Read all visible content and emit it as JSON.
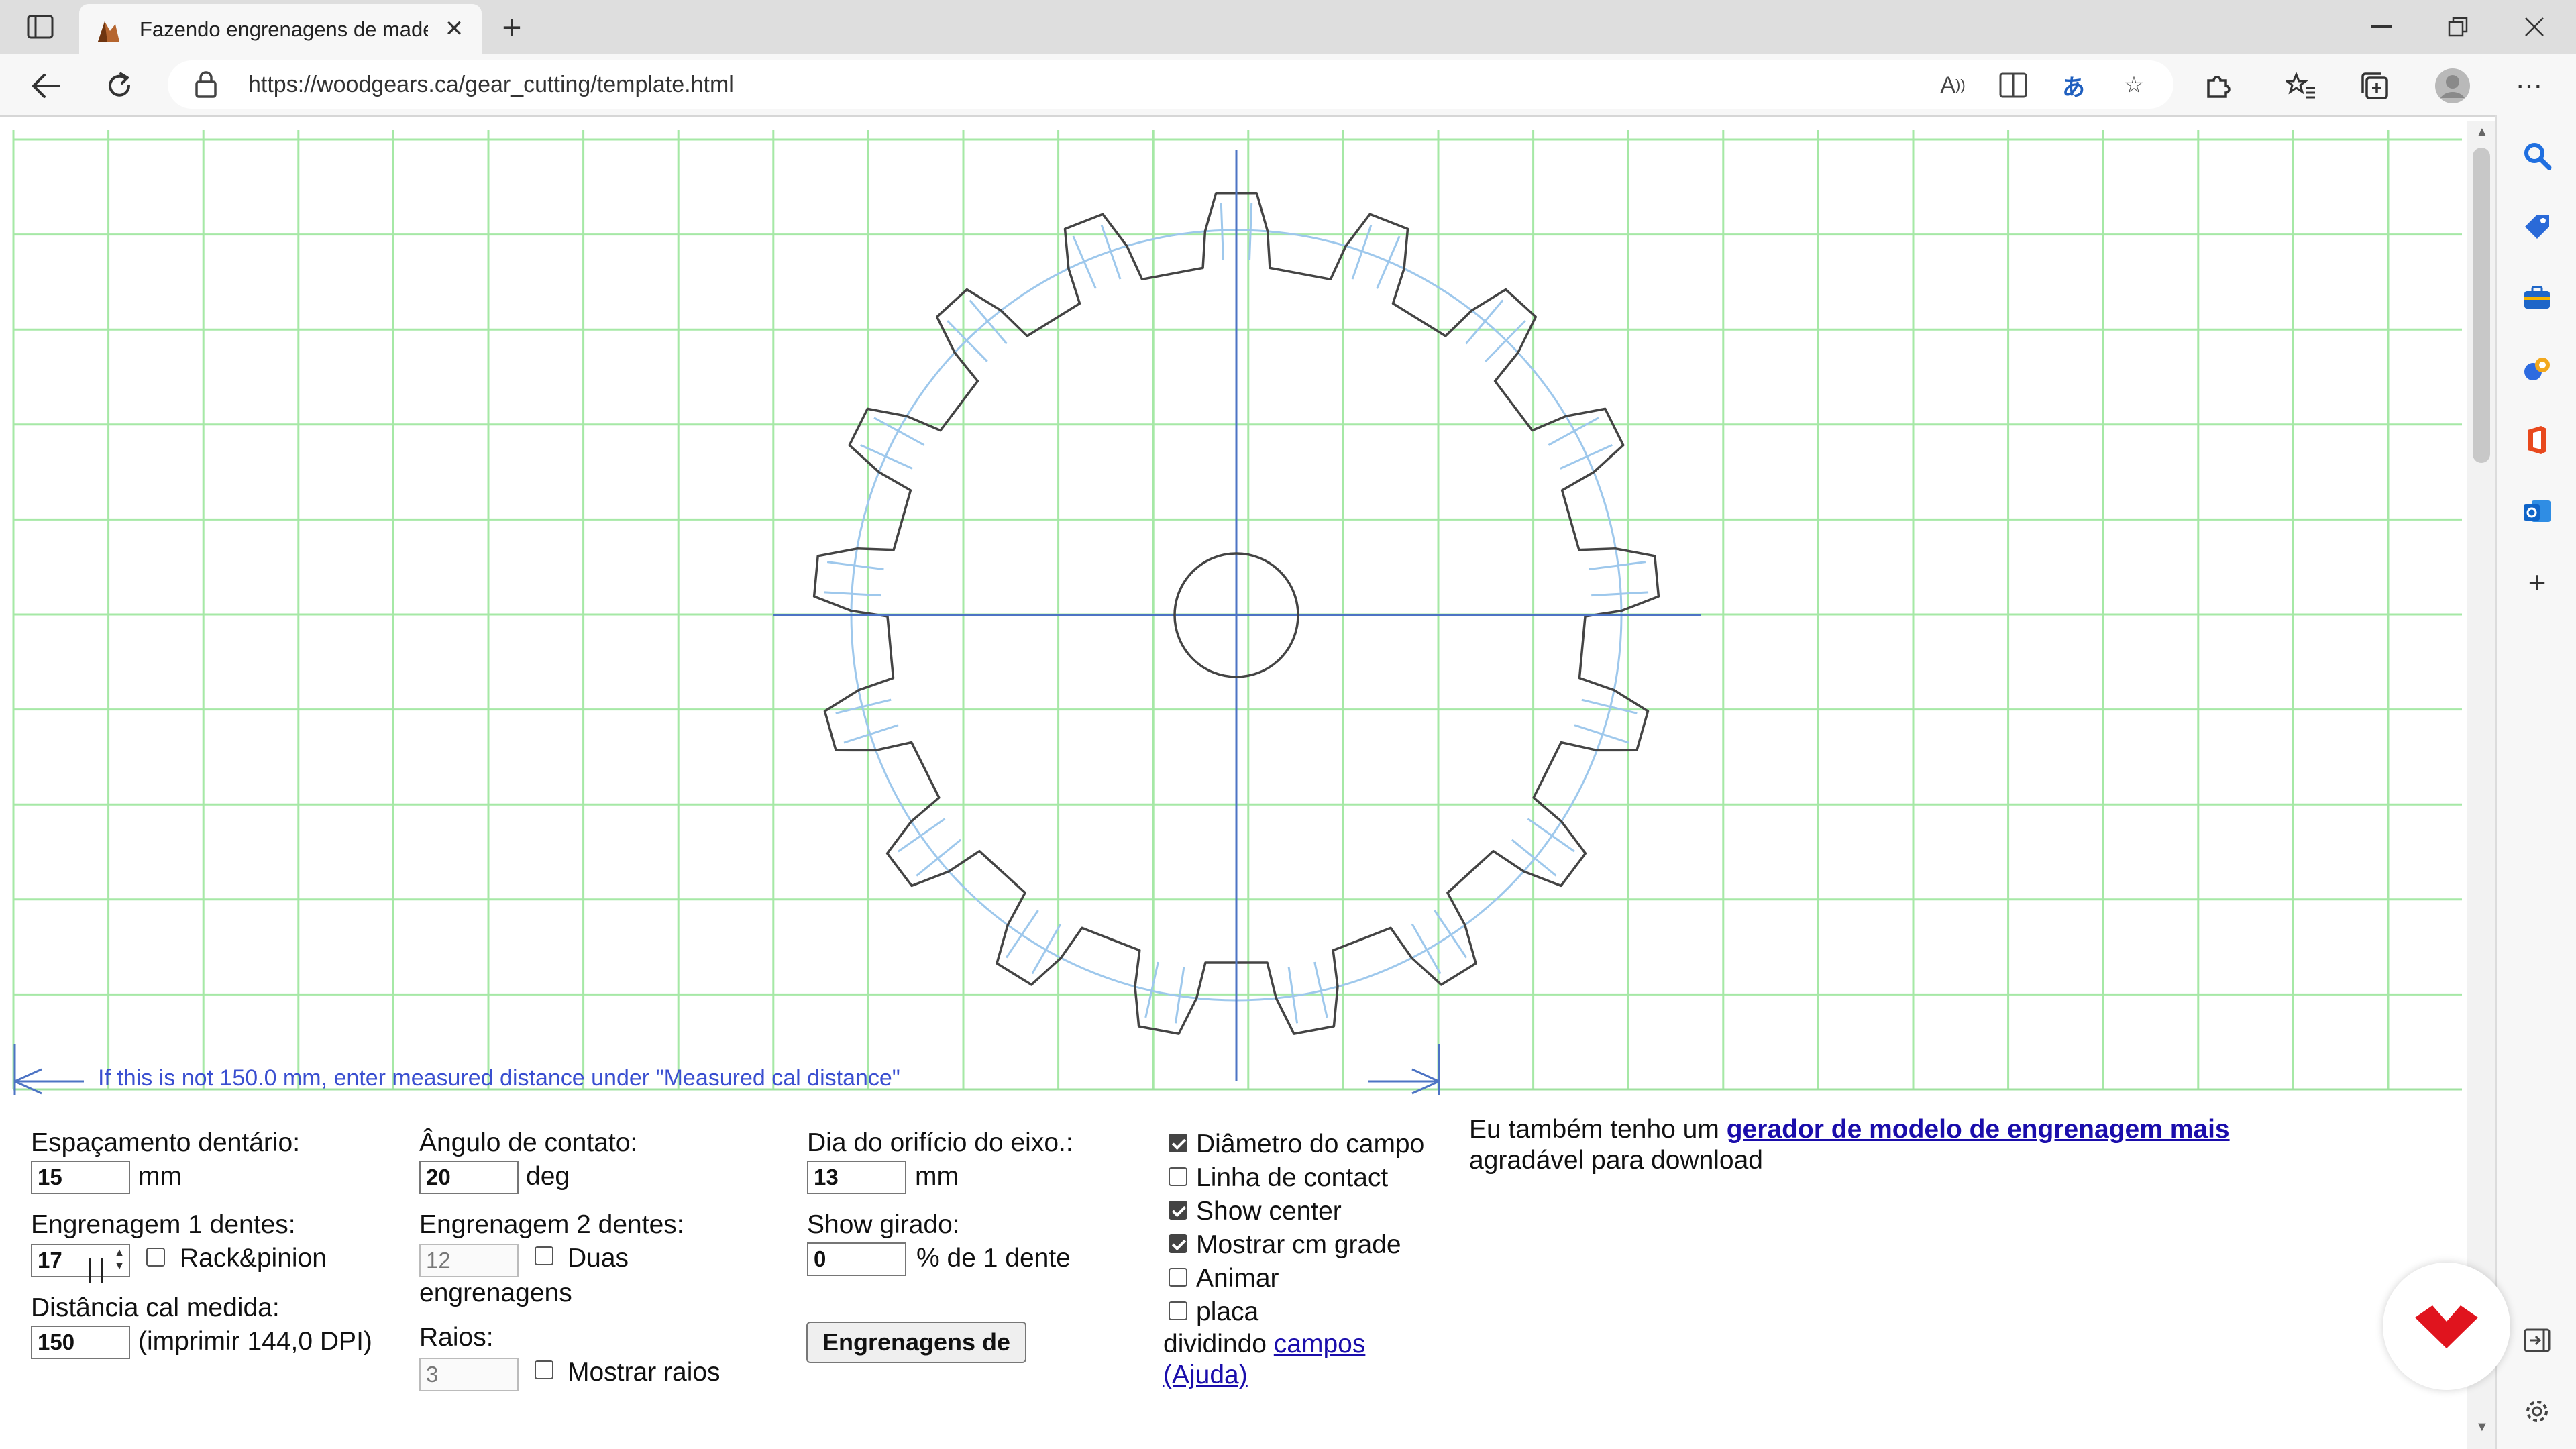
{
  "browser": {
    "tab": {
      "title": "Fazendo engrenagens de madeira"
    },
    "address": {
      "url": "https://woodgears.ca/gear_cutting/template.html"
    }
  },
  "template": {
    "calibration_text": "If this is not 150.0 mm, enter measured distance under \"Measured cal distance\"",
    "gear": {
      "teeth": 17
    }
  },
  "form": {
    "tooth_spacing": {
      "label": "Espaçamento dentário:",
      "value": "15",
      "unit": "mm"
    },
    "gear1_teeth": {
      "label": "Engrenagem 1 dentes:",
      "value": "17",
      "rack_label": "Rack&pinion",
      "rack_checked": false
    },
    "cal_distance": {
      "label": "Distância cal medida:",
      "value": "150",
      "note": "(imprimir 144,0 DPI)"
    },
    "contact_angle": {
      "label": "Ângulo de contato:",
      "value": "20",
      "unit": "deg"
    },
    "gear2_teeth": {
      "label": "Engrenagem 2 dentes:",
      "value": "12",
      "two_gears_label": "Duas",
      "two_gears_label2": "engrenagens",
      "two_gears_checked": false
    },
    "spokes": {
      "label": "Raios:",
      "value": "3",
      "show_label": "Mostrar raios",
      "show_checked": false
    },
    "shaft_hole": {
      "label": "Dia do orifício do eixo.:",
      "value": "13",
      "unit": "mm"
    },
    "rotated": {
      "label": "Show girado:",
      "value": "0",
      "unit": "% de 1 dente"
    },
    "gears_button": "Engrenagens de",
    "options": [
      {
        "label": "Diâmetro do campo",
        "checked": true
      },
      {
        "label": "Linha de contact",
        "checked": false
      },
      {
        "label": "Show center",
        "checked": true
      },
      {
        "label": "Mostrar cm grade",
        "checked": true
      },
      {
        "label": "Animar",
        "checked": false
      },
      {
        "label": "placa",
        "checked": false
      }
    ],
    "dividing_text": "dividindo",
    "fields_link": "campos",
    "help_link": "(Ajuda)"
  },
  "promo": {
    "prefix": "Eu também tenho um",
    "link": "gerador de modelo de engrenagem mais",
    "suffix": "agradável para download"
  },
  "colors": {
    "grid": "#a6e8a6",
    "gear_outline": "#444444",
    "pitch_circle": "#9ec8ec",
    "axes": "#4d74c4",
    "cal_text": "#3a4fd0"
  }
}
